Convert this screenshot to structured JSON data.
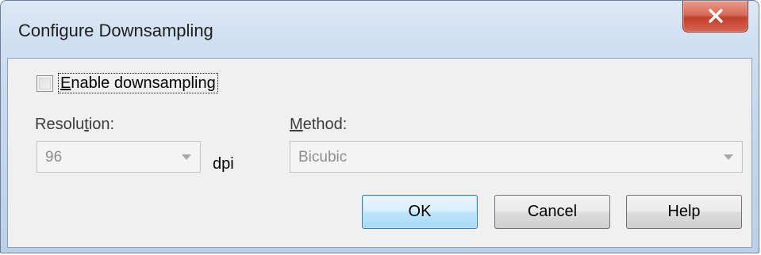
{
  "window": {
    "title": "Configure Downsampling",
    "close_icon": "close-icon"
  },
  "downsampling": {
    "checkbox_checked": false,
    "checkbox_label_accel": "E",
    "checkbox_label_rest": "nable downsampling"
  },
  "resolution": {
    "label_before": "Resolu",
    "label_accel": "t",
    "label_after": "ion:",
    "value": "96",
    "unit": "dpi",
    "enabled": false
  },
  "method": {
    "label_accel": "M",
    "label_rest": "ethod:",
    "value": "Bicubic",
    "enabled": false
  },
  "buttons": {
    "ok": "OK",
    "cancel": "Cancel",
    "help": "Help"
  },
  "colors": {
    "close_button": "#c7432f",
    "default_button_border": "#3c7fb1",
    "disabled_text": "#8d8d8d"
  }
}
